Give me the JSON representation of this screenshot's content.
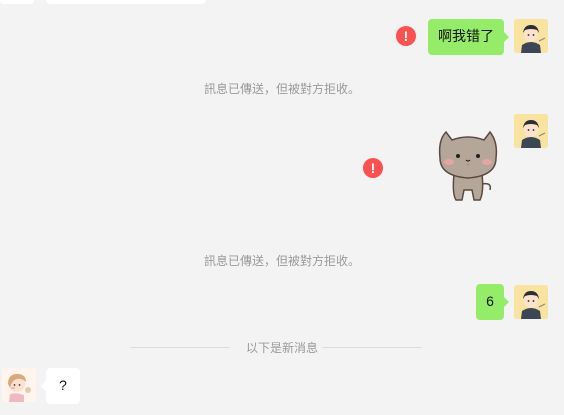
{
  "messages": [
    {
      "id": "m1",
      "side": "mine",
      "text": "啊我错了",
      "failed": true,
      "error_icon": "!"
    },
    {
      "id": "m2",
      "side": "mine",
      "type": "sticker",
      "sticker": "cat-sticker",
      "failed": true,
      "error_icon": "!"
    },
    {
      "id": "m3",
      "side": "mine",
      "text": "6"
    },
    {
      "id": "m4",
      "side": "theirs",
      "text": "?"
    }
  ],
  "system": {
    "rejected_1": "訊息已傳送，但被對方拒收。",
    "rejected_2": "訊息已傳送，但被對方拒收。",
    "new_messages_divider": "以下是新消息"
  },
  "colors": {
    "background": "#f3f3f3",
    "mine_bubble": "#95ec69",
    "theirs_bubble": "#ffffff",
    "error": "#fa5151",
    "system_text": "#9a9a9a"
  }
}
